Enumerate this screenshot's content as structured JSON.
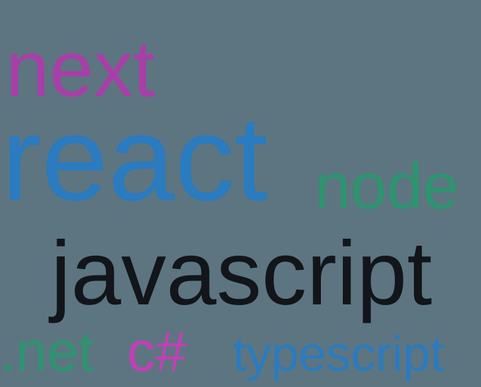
{
  "words": {
    "next": {
      "text": "next",
      "color": "#a83fa8"
    },
    "react": {
      "text": "react",
      "color": "#2a7bbf"
    },
    "node": {
      "text": "node",
      "color": "#2d9470"
    },
    "javascript": {
      "text": "javascript",
      "color": "#12151a"
    },
    "dotnet": {
      "text": ".net",
      "color": "#2d9470"
    },
    "csharp": {
      "text": "c#",
      "color": "#c23fb8"
    },
    "typescript": {
      "text": "typescript",
      "color": "#2a7bbf"
    }
  }
}
